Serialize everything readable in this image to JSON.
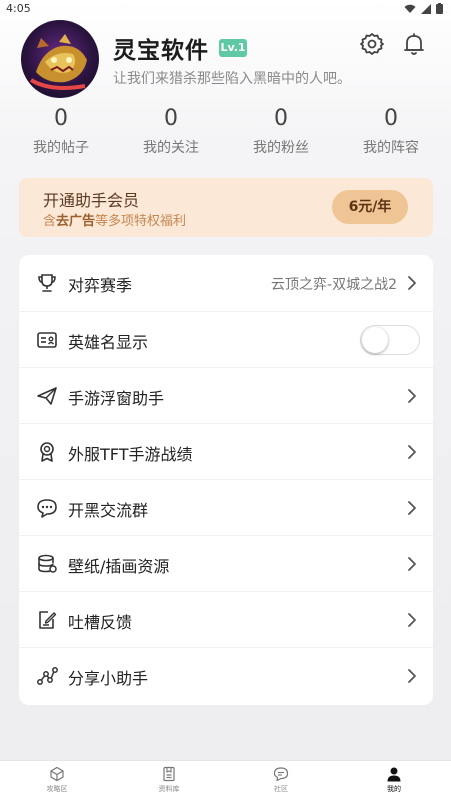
{
  "status_bar": {
    "time": "4:05"
  },
  "profile": {
    "name": "灵宝软件",
    "level": "Lv.1",
    "slogan": "让我们来猎杀那些陷入黑暗中的人吧。"
  },
  "stats": [
    {
      "value": "0",
      "label": "我的帖子"
    },
    {
      "value": "0",
      "label": "我的关注"
    },
    {
      "value": "0",
      "label": "我的粉丝"
    },
    {
      "value": "0",
      "label": "我的阵容"
    }
  ],
  "vip": {
    "title": "开通助手会员",
    "sub_prefix": "含",
    "sub_bold": "去广告",
    "sub_suffix": "等多项特权福利",
    "price": "6元/年"
  },
  "menu": [
    {
      "label": "对弈赛季",
      "value": "云顶之弈-双城之战2",
      "icon": "trophy-icon"
    },
    {
      "label": "英雄名显示",
      "toggle_on": false,
      "icon": "id-card-icon"
    },
    {
      "label": "手游浮窗助手",
      "icon": "paper-plane-icon"
    },
    {
      "label": "外服TFT手游战绩",
      "icon": "medal-icon"
    },
    {
      "label": "开黑交流群",
      "icon": "chat-bubble-icon"
    },
    {
      "label": "壁纸/插画资源",
      "icon": "database-icon"
    },
    {
      "label": "吐槽反馈",
      "icon": "edit-note-icon"
    },
    {
      "label": "分享小助手",
      "icon": "share-icon"
    }
  ],
  "bottom_nav": [
    {
      "label": "攻略区",
      "icon": "cube-icon",
      "active": false
    },
    {
      "label": "资料库",
      "icon": "document-icon",
      "active": false
    },
    {
      "label": "社区",
      "icon": "chat-icon",
      "active": false
    },
    {
      "label": "我的",
      "icon": "person-icon",
      "active": true
    }
  ],
  "colors": {
    "accent_green": "#5ec9a4",
    "vip_bg": "#fbe8d6",
    "vip_button": "#efc596"
  }
}
